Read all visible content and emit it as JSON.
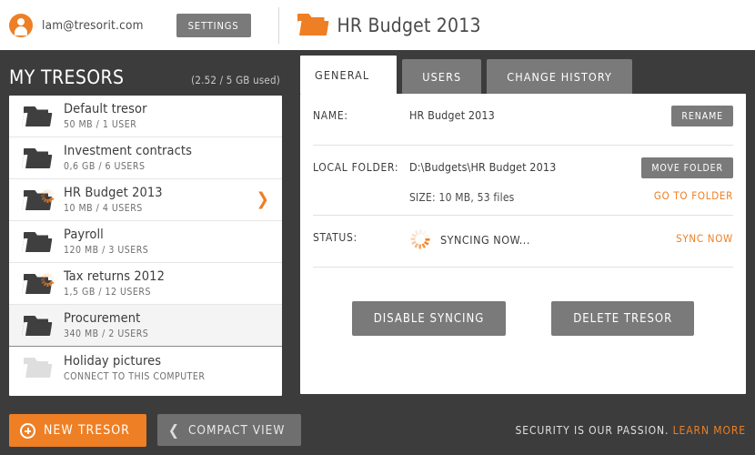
{
  "topbar": {
    "account_email": "lam@tresorit.com",
    "settings_label": "SETTINGS",
    "tresor_title": "HR Budget 2013"
  },
  "sidebar": {
    "title": "MY TRESORS",
    "quota": "(2.52 / 5 GB used)",
    "items": [
      {
        "name": "Default tresor",
        "meta": "50 MB / 1 USER",
        "syncing": false,
        "selected": false,
        "disabled": false,
        "chevron": false
      },
      {
        "name": "Investment contracts",
        "meta": "0,6 GB / 6 USERS",
        "syncing": false,
        "selected": false,
        "disabled": false,
        "chevron": false
      },
      {
        "name": "HR Budget 2013",
        "meta": "10 MB / 4 USERS",
        "syncing": true,
        "selected": false,
        "disabled": false,
        "chevron": true
      },
      {
        "name": "Payroll",
        "meta": "120 MB / 3 USERS",
        "syncing": false,
        "selected": false,
        "disabled": false,
        "chevron": false
      },
      {
        "name": "Tax returns 2012",
        "meta": "1,5 GB / 12 USERS",
        "syncing": true,
        "selected": false,
        "disabled": false,
        "chevron": false
      },
      {
        "name": "Procurement",
        "meta": "340 MB / 2 USERS",
        "syncing": false,
        "selected": true,
        "disabled": false,
        "chevron": false
      },
      {
        "name": "Holiday pictures",
        "meta": "CONNECT TO THIS COMPUTER",
        "syncing": false,
        "selected": false,
        "disabled": true,
        "chevron": false
      }
    ]
  },
  "panel": {
    "tabs": [
      {
        "label": "GENERAL",
        "active": true
      },
      {
        "label": "USERS",
        "active": false
      },
      {
        "label": "CHANGE HISTORY",
        "active": false
      }
    ],
    "name_label": "NAME:",
    "name_value": "HR Budget 2013",
    "rename_label": "RENAME",
    "local_folder_label": "LOCAL FOLDER:",
    "local_folder_value": "D:\\Budgets\\HR Budget 2013",
    "move_folder_label": "MOVE FOLDER",
    "size_text": "SIZE: 10 MB, 53 files",
    "go_to_folder_label": "GO TO FOLDER",
    "status_label": "STATUS:",
    "status_value": "SYNCING NOW...",
    "sync_now_label": "SYNC NOW",
    "disable_syncing_label": "DISABLE SYNCING",
    "delete_tresor_label": "DELETE TRESOR"
  },
  "bottombar": {
    "new_tresor_label": "NEW TRESOR",
    "compact_view_label": "COMPACT VIEW",
    "tagline_text": "SECURITY IS OUR PASSION.",
    "learn_more_label": "LEARN MORE"
  },
  "colors": {
    "accent": "#ee7f24",
    "dark_bg": "#3c3c3c",
    "gray_button": "#7a7a7a",
    "panel_bg": "#ffffff"
  }
}
